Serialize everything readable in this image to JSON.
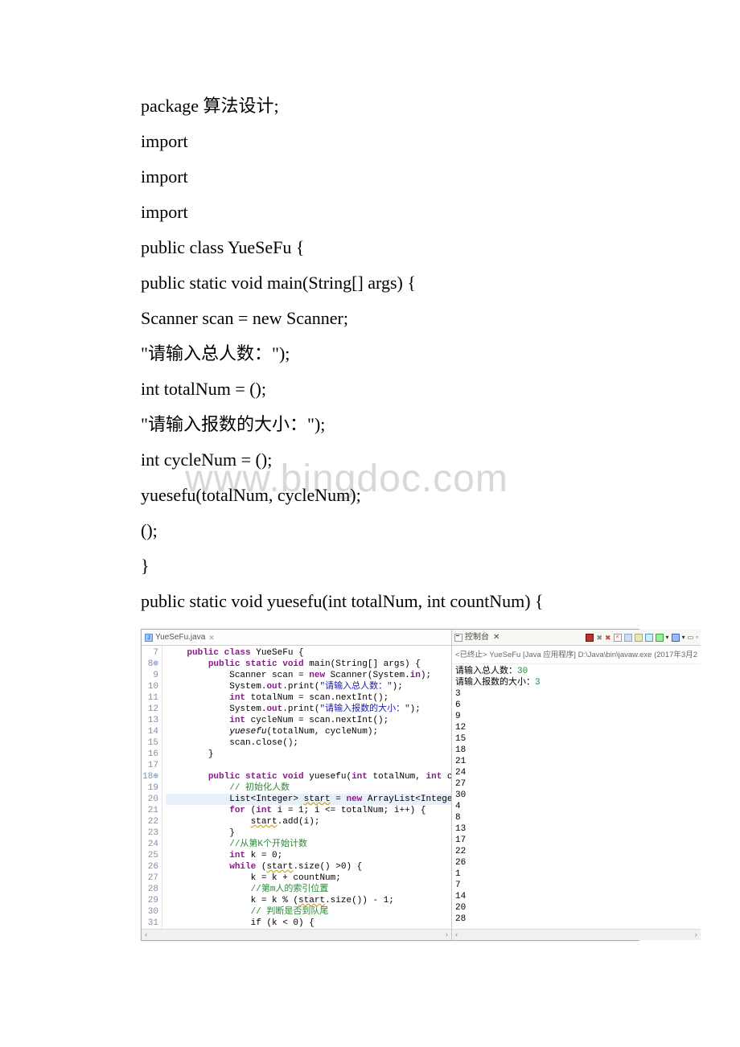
{
  "doc": {
    "lines": [
      "package 算法设计;",
      "import",
      "import",
      "import",
      "",
      "public class YueSeFu {",
      " public static void main(String[] args) {",
      " Scanner scan = new Scanner;",
      " \"请输入总人数：\");",
      " int totalNum = ();",
      " \"请输入报数的大小：\");",
      " int cycleNum = ();",
      " yuesefu(totalNum, cycleNum);",
      " ();",
      " }",
      "",
      " public static void yuesefu(int totalNum, int countNum) {"
    ]
  },
  "watermark": "www.bingdoc.com",
  "ide": {
    "tab_label": "YueSeFu.java",
    "gutter": [
      "7",
      "8",
      "9",
      "10",
      "11",
      "12",
      "13",
      "14",
      "15",
      "16",
      "17",
      "18",
      "19",
      "20",
      "21",
      "22",
      "23",
      "24",
      "25",
      "26",
      "27",
      "28",
      "29",
      "30",
      "31"
    ],
    "gutter_markers": {
      "1": "⊕",
      "11": "⊕"
    },
    "code_lines": [
      {
        "indent": 1,
        "tokens": [
          {
            "t": "public class",
            "c": "kw"
          },
          {
            "t": " YueSeFu {"
          }
        ]
      },
      {
        "indent": 2,
        "tokens": [
          {
            "t": "public static void",
            "c": "kw"
          },
          {
            "t": " main(String[] args) {"
          }
        ]
      },
      {
        "indent": 3,
        "tokens": [
          {
            "t": "Scanner scan = "
          },
          {
            "t": "new",
            "c": "kw"
          },
          {
            "t": " Scanner(System."
          },
          {
            "t": "in",
            "c": "kw"
          },
          {
            "t": ");"
          }
        ]
      },
      {
        "indent": 3,
        "tokens": [
          {
            "t": "System."
          },
          {
            "t": "out",
            "c": "kw"
          },
          {
            "t": ".print("
          },
          {
            "t": "\"请输入总人数：\"",
            "c": "str"
          },
          {
            "t": ");"
          }
        ]
      },
      {
        "indent": 3,
        "tokens": [
          {
            "t": "int",
            "c": "kw"
          },
          {
            "t": " totalNum = scan.nextInt();"
          }
        ]
      },
      {
        "indent": 3,
        "tokens": [
          {
            "t": "System."
          },
          {
            "t": "out",
            "c": "kw"
          },
          {
            "t": ".print("
          },
          {
            "t": "\"请输入报数的大小：\"",
            "c": "str"
          },
          {
            "t": ");"
          }
        ]
      },
      {
        "indent": 3,
        "tokens": [
          {
            "t": "int",
            "c": "kw"
          },
          {
            "t": " cycleNum = scan.nextInt();"
          }
        ]
      },
      {
        "indent": 3,
        "tokens": [
          {
            "t": "yuesefu",
            "c": "mth"
          },
          {
            "t": "(totalNum, cycleNum);"
          }
        ]
      },
      {
        "indent": 3,
        "tokens": [
          {
            "t": "scan.close();"
          }
        ]
      },
      {
        "indent": 2,
        "tokens": [
          {
            "t": "}"
          }
        ]
      },
      {
        "indent": 0,
        "tokens": [
          {
            "t": ""
          }
        ]
      },
      {
        "indent": 2,
        "tokens": [
          {
            "t": "public static void",
            "c": "kw"
          },
          {
            "t": " yuesefu("
          },
          {
            "t": "int",
            "c": "kw"
          },
          {
            "t": " totalNum, "
          },
          {
            "t": "int",
            "c": "kw"
          },
          {
            "t": " cou"
          }
        ]
      },
      {
        "indent": 3,
        "tokens": [
          {
            "t": "// 初始化人数",
            "c": "cm"
          }
        ]
      },
      {
        "indent": 3,
        "hl": true,
        "tokens": [
          {
            "t": "List<Integer> "
          },
          {
            "t": "start",
            "c": "warn"
          },
          {
            "t": " = "
          },
          {
            "t": "new",
            "c": "kw"
          },
          {
            "t": " ArrayList<Intege"
          }
        ]
      },
      {
        "indent": 3,
        "tokens": [
          {
            "t": "for",
            "c": "kw"
          },
          {
            "t": " ("
          },
          {
            "t": "int",
            "c": "kw"
          },
          {
            "t": " i = 1; i <= totalNum; i++) {"
          }
        ]
      },
      {
        "indent": 4,
        "tokens": [
          {
            "t": "start",
            "c": "warn"
          },
          {
            "t": ".add(i);"
          }
        ]
      },
      {
        "indent": 3,
        "tokens": [
          {
            "t": "}"
          }
        ]
      },
      {
        "indent": 3,
        "tokens": [
          {
            "t": "//从第K个开始计数",
            "c": "cm"
          }
        ]
      },
      {
        "indent": 3,
        "tokens": [
          {
            "t": "int",
            "c": "kw"
          },
          {
            "t": " k = 0;"
          }
        ]
      },
      {
        "indent": 3,
        "tokens": [
          {
            "t": "while",
            "c": "kw"
          },
          {
            "t": " ("
          },
          {
            "t": "start",
            "c": "warn"
          },
          {
            "t": ".size() >0) {"
          }
        ]
      },
      {
        "indent": 4,
        "tokens": [
          {
            "t": "k = k + countNum;"
          }
        ]
      },
      {
        "indent": 4,
        "tokens": [
          {
            "t": "//第m人的索引位置",
            "c": "cm"
          }
        ]
      },
      {
        "indent": 4,
        "tokens": [
          {
            "t": "k = k % ("
          },
          {
            "t": "start",
            "c": "warn"
          },
          {
            "t": ".size()) - 1;"
          }
        ]
      },
      {
        "indent": 4,
        "tokens": [
          {
            "t": "// 判断是否到队尾",
            "c": "cm"
          }
        ]
      },
      {
        "indent": 4,
        "tokens": [
          {
            "t": "if (k < 0) {"
          }
        ]
      }
    ],
    "console": {
      "title": "控制台",
      "sub": "<已终止> YueSeFu [Java 应用程序] D:\\Java\\bin\\javaw.exe (2017年3月2",
      "lines": [
        {
          "text": "请输入总人数：",
          "in": "30"
        },
        {
          "text": "请输入报数的大小：",
          "in": "3"
        },
        {
          "text": "3"
        },
        {
          "text": "6"
        },
        {
          "text": "9"
        },
        {
          "text": "12"
        },
        {
          "text": "15"
        },
        {
          "text": "18"
        },
        {
          "text": "21"
        },
        {
          "text": "24"
        },
        {
          "text": "27"
        },
        {
          "text": "30"
        },
        {
          "text": "4"
        },
        {
          "text": "8"
        },
        {
          "text": "13"
        },
        {
          "text": "17"
        },
        {
          "text": "22"
        },
        {
          "text": "26"
        },
        {
          "text": "1"
        },
        {
          "text": "7"
        },
        {
          "text": "14"
        },
        {
          "text": "20"
        },
        {
          "text": "28"
        }
      ]
    }
  }
}
